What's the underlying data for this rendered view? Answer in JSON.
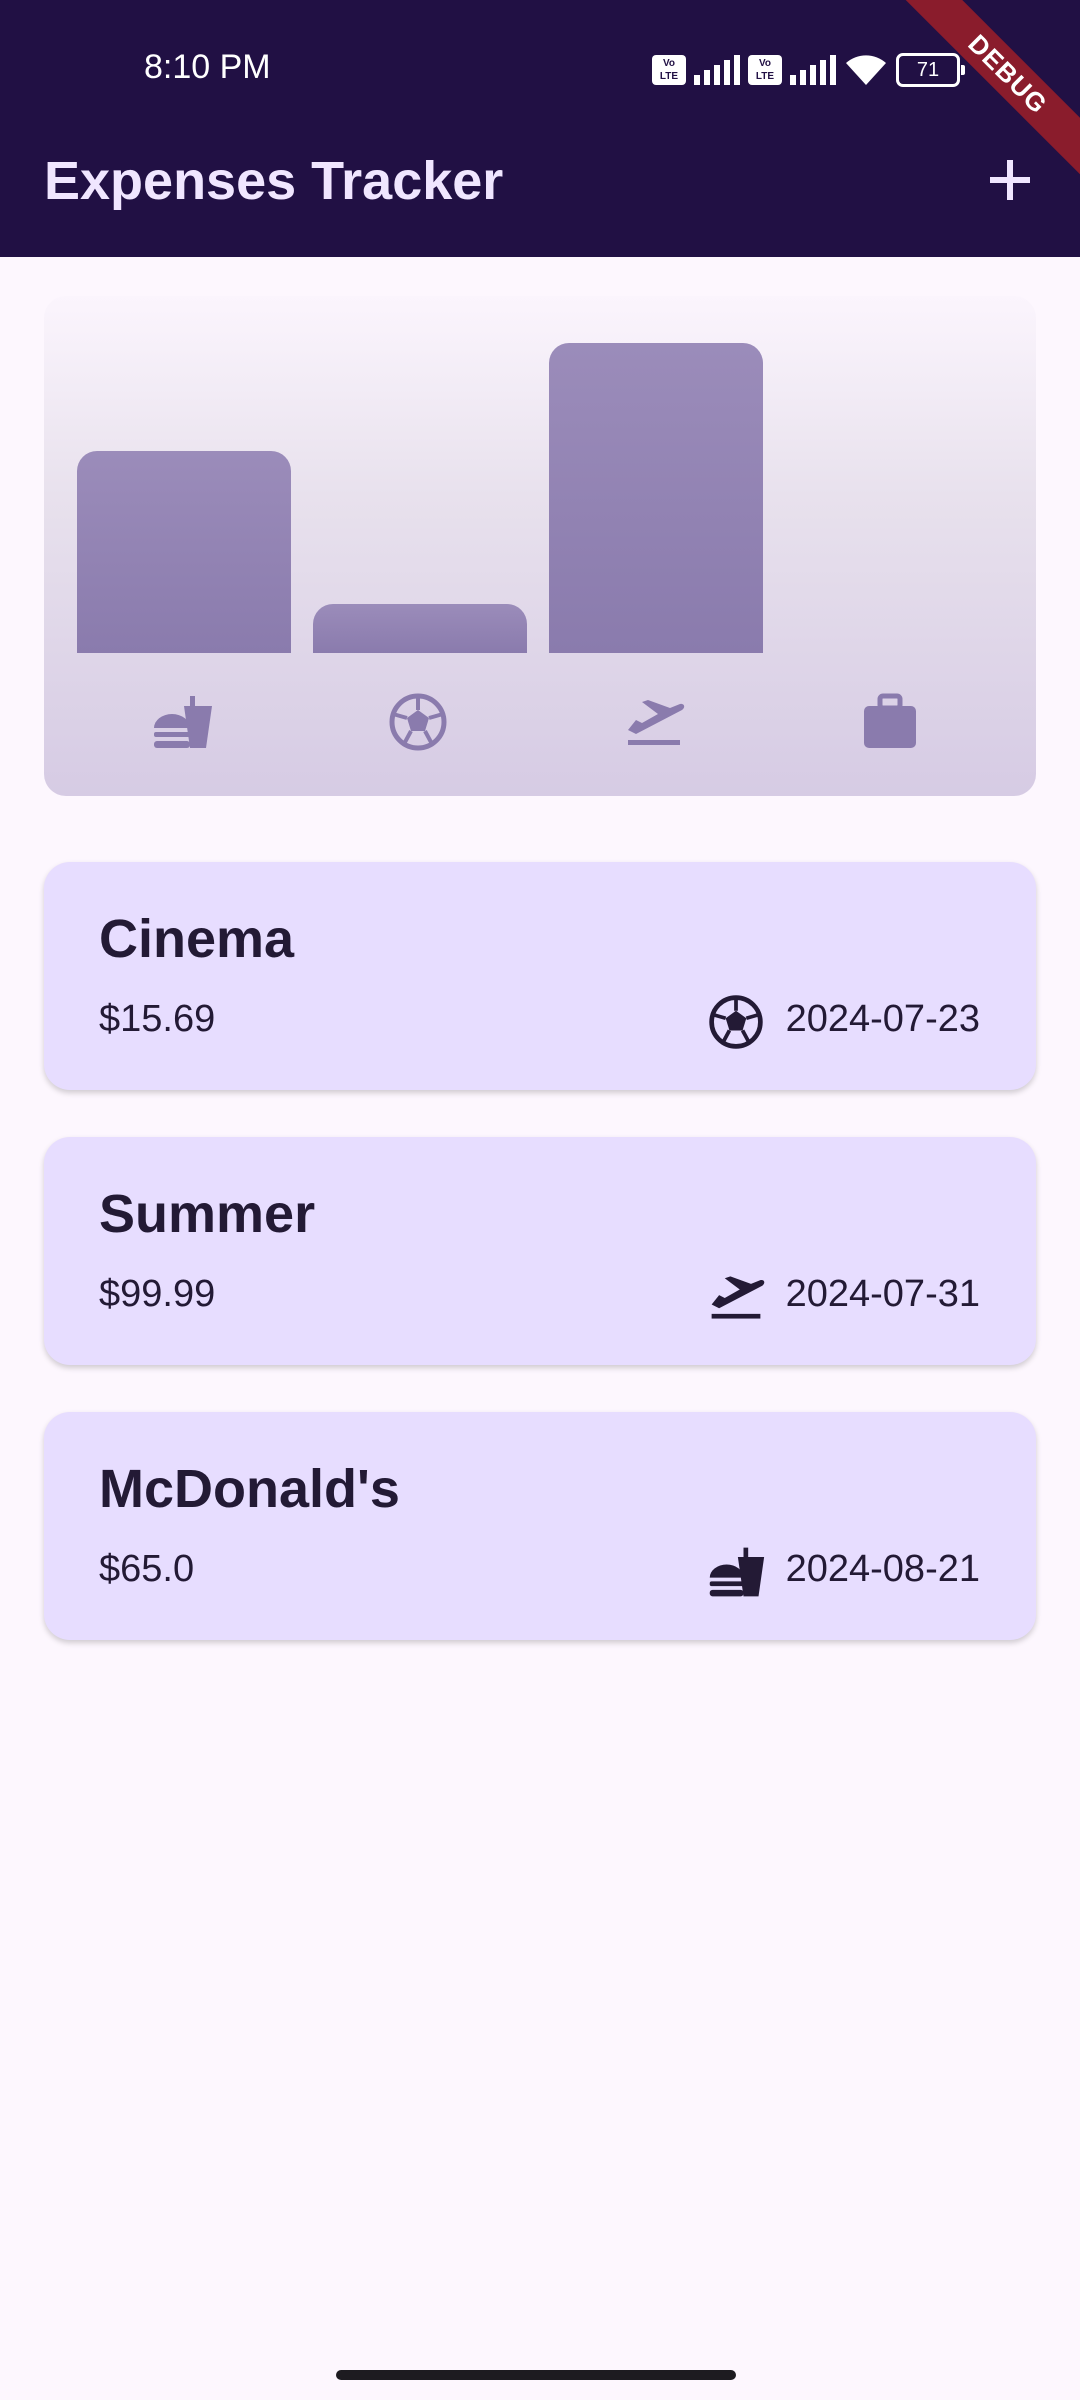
{
  "status_bar": {
    "time": "8:10 PM",
    "volte_label_1": "Vo",
    "volte_label_2": "LTE",
    "battery": "71"
  },
  "debug_banner": "DEBUG",
  "app_bar": {
    "title": "Expenses Tracker",
    "add_icon": "plus-icon"
  },
  "chart_data": {
    "type": "bar",
    "categories": [
      "food",
      "leisure",
      "travel",
      "work"
    ],
    "category_icons": [
      "fastfood-icon",
      "sports-soccer-icon",
      "flight-takeoff-icon",
      "work-icon"
    ],
    "values": [
      65.0,
      15.69,
      99.99,
      0
    ],
    "ylim": [
      0,
      99.99
    ],
    "bar_color": "#9385b3"
  },
  "expenses": [
    {
      "title": "Cinema",
      "amount": "$15.69",
      "category_icon": "sports-soccer-icon",
      "date": "2024-07-23"
    },
    {
      "title": "Summer",
      "amount": "$99.99",
      "category_icon": "flight-takeoff-icon",
      "date": "2024-07-31"
    },
    {
      "title": "McDonald's",
      "amount": "$65.0",
      "category_icon": "fastfood-icon",
      "date": "2024-08-21"
    }
  ],
  "colors": {
    "app_bar": "#211044",
    "background": "#fdf7fe",
    "card": "#e7ddff",
    "text": "#231a35"
  }
}
